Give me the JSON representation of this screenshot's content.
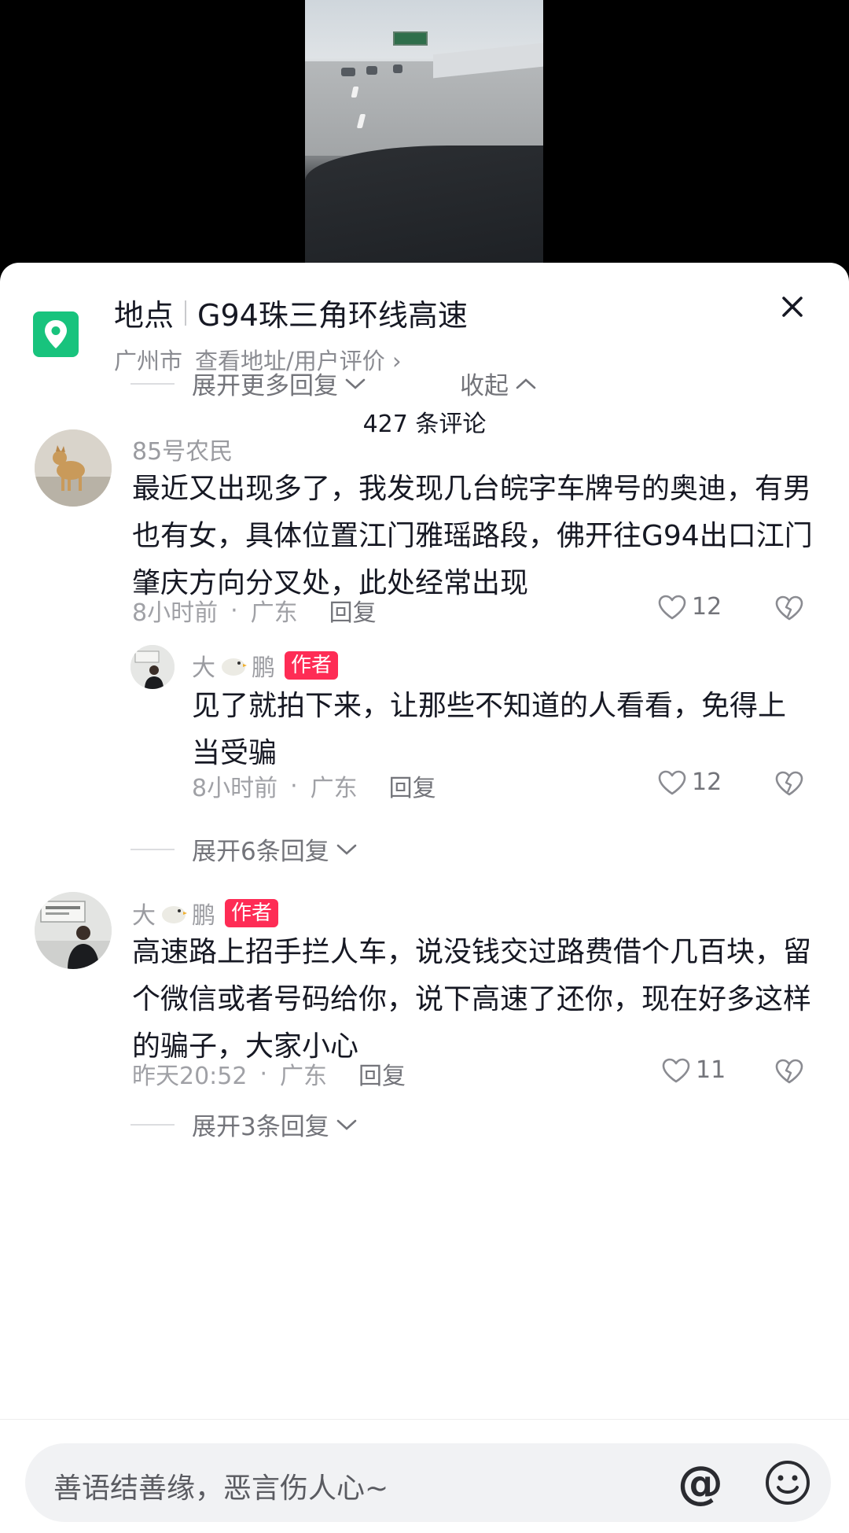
{
  "location": {
    "prefix": "地点",
    "name": "G94珠三角环线高速",
    "city": "广州市",
    "address_link": "查看地址/用户评价 ›"
  },
  "comments_count": "427 条评论",
  "top_controls": {
    "expand_more": "展开更多回复",
    "collapse": "收起"
  },
  "comments": [
    {
      "username": "85号农民",
      "text": "最近又出现多了，我发现几台皖字车牌号的奥迪，有男也有女，具体位置江门雅瑶路段，佛开往G94出口江门肇庆方向分叉处，此处经常出现",
      "time": "8小时前",
      "region": "广东",
      "reply": "回复",
      "likes": "12"
    },
    {
      "username_pre": "大",
      "username_post": "鹏",
      "badge": "作者",
      "text": "见了就拍下来，让那些不知道的人看看，免得上当受骗",
      "time": "8小时前",
      "region": "广东",
      "reply": "回复",
      "likes": "12",
      "expand": "展开6条回复"
    },
    {
      "username_pre": "大",
      "username_post": "鹏",
      "badge": "作者",
      "text": "高速路上招手拦人车，说没钱交过路费借个几百块，留个微信或者号码给你，说下高速了还你，现在好多这样的骗子，大家小心",
      "time": "昨天20:52",
      "region": "广东",
      "reply": "回复",
      "likes": "11",
      "expand": "展开3条回复"
    }
  ],
  "input": {
    "placeholder": "善语结善缘，恶言伤人心~",
    "at_symbol": "@"
  },
  "colors": {
    "accent_red": "#fe2c55",
    "location_green": "#18c37d"
  },
  "icons": [
    "location-pin-icon",
    "close-icon",
    "chevron-down-icon",
    "chevron-up-icon",
    "heart-icon",
    "broken-heart-icon",
    "emoji-icon"
  ]
}
